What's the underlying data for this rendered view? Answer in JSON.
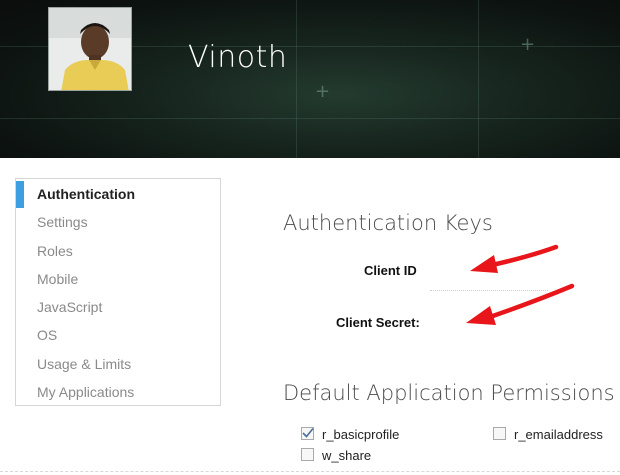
{
  "profile": {
    "name": "Vinoth",
    "avatar_icon": "person-photo-icon"
  },
  "sidebar": {
    "items": [
      {
        "label": "Authentication",
        "active": true
      },
      {
        "label": "Settings",
        "active": false
      },
      {
        "label": "Roles",
        "active": false
      },
      {
        "label": "Mobile",
        "active": false
      },
      {
        "label": "JavaScript",
        "active": false
      },
      {
        "label": "OS",
        "active": false
      },
      {
        "label": "Usage & Limits",
        "active": false
      },
      {
        "label": "My Applications",
        "active": false
      }
    ],
    "active_color": "#3d9fe0"
  },
  "auth_keys": {
    "heading": "Authentication Keys",
    "client_id_label": "Client ID",
    "client_secret_label": "Client Secret:"
  },
  "permissions": {
    "heading": "Default Application Permissions",
    "items": [
      {
        "label": "r_basicprofile",
        "checked": true
      },
      {
        "label": "r_emailaddress",
        "checked": false
      },
      {
        "label": "w_share",
        "checked": false
      }
    ]
  },
  "annotations": {
    "arrow_color": "#e8161b",
    "arrow_icon": "red-pointer-arrow-icon"
  }
}
